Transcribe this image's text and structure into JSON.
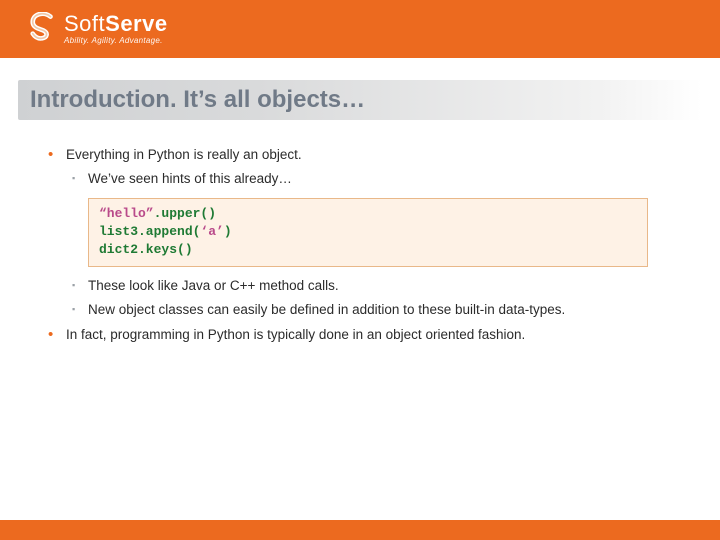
{
  "logo": {
    "name_a": "Soft",
    "name_b": "Serve",
    "tagline": "Ability. Agility. Advantage."
  },
  "title": "Introduction. It’s all objects…",
  "bullets": {
    "b1": "Everything in Python is really an object.",
    "b1_1": "We’ve seen hints of this already…",
    "b1_2": "These look like Java or C++ method calls.",
    "b1_3": "New object classes can easily be defined in addition to these built-in data-types.",
    "b2": "In fact, programming in Python is typically done in an object oriented fashion."
  },
  "code": {
    "l1_a": "“hello”",
    "l1_b": ".upper()",
    "l2_a": "list3.append(",
    "l2_b": "‘a’",
    "l2_c": ")",
    "l3": "dict2.keys()"
  }
}
